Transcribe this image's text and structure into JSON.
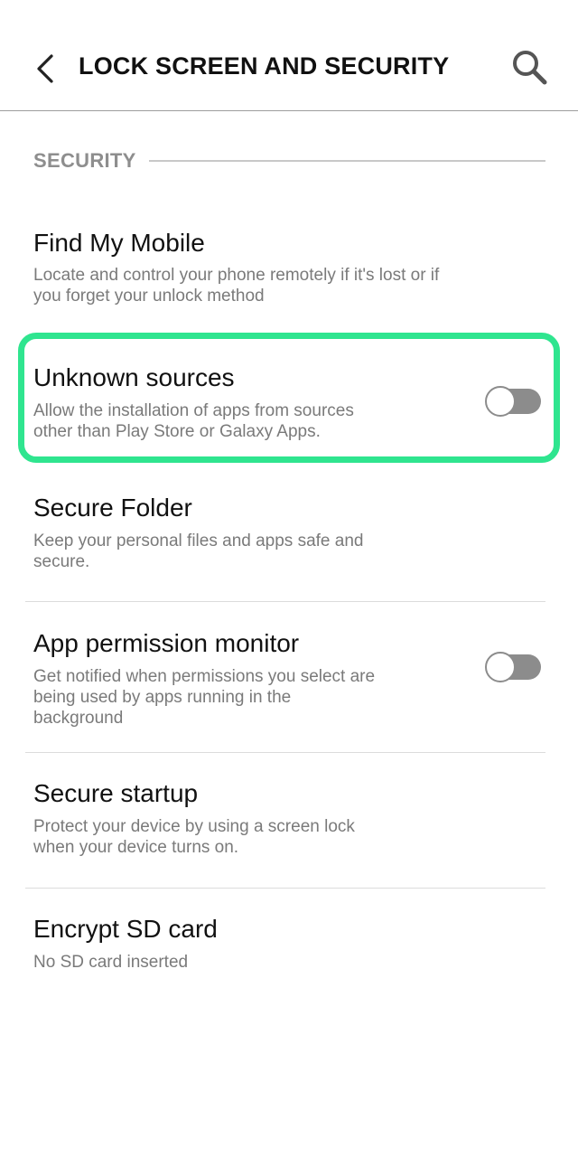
{
  "header": {
    "title": "LOCK SCREEN AND SECURITY"
  },
  "section": {
    "label": "SECURITY"
  },
  "items": [
    {
      "title": "Find My Mobile",
      "description": "Locate and control your phone remotely if it's lost or if you forget your unlock method"
    },
    {
      "title": "Unknown sources",
      "description": "Allow the installation of apps from sources other than Play Store or Galaxy Apps.",
      "toggle_on": false
    },
    {
      "title": "Secure Folder",
      "description": "Keep your personal files and apps safe and secure."
    },
    {
      "title": "App permission monitor",
      "description": "Get notified when permissions you select are being used by apps running in the background",
      "toggle_on": false
    },
    {
      "title": "Secure startup",
      "description": "Protect your device by using a screen lock when your device turns on."
    },
    {
      "title": "Encrypt SD card",
      "description": "No SD card inserted"
    }
  ],
  "colors": {
    "highlight": "#2fe58f",
    "toggle_off": "#8c8c8c",
    "section_label": "#8e8e8e"
  },
  "icons": {
    "back": "back-arrow-icon",
    "search": "search-icon"
  }
}
